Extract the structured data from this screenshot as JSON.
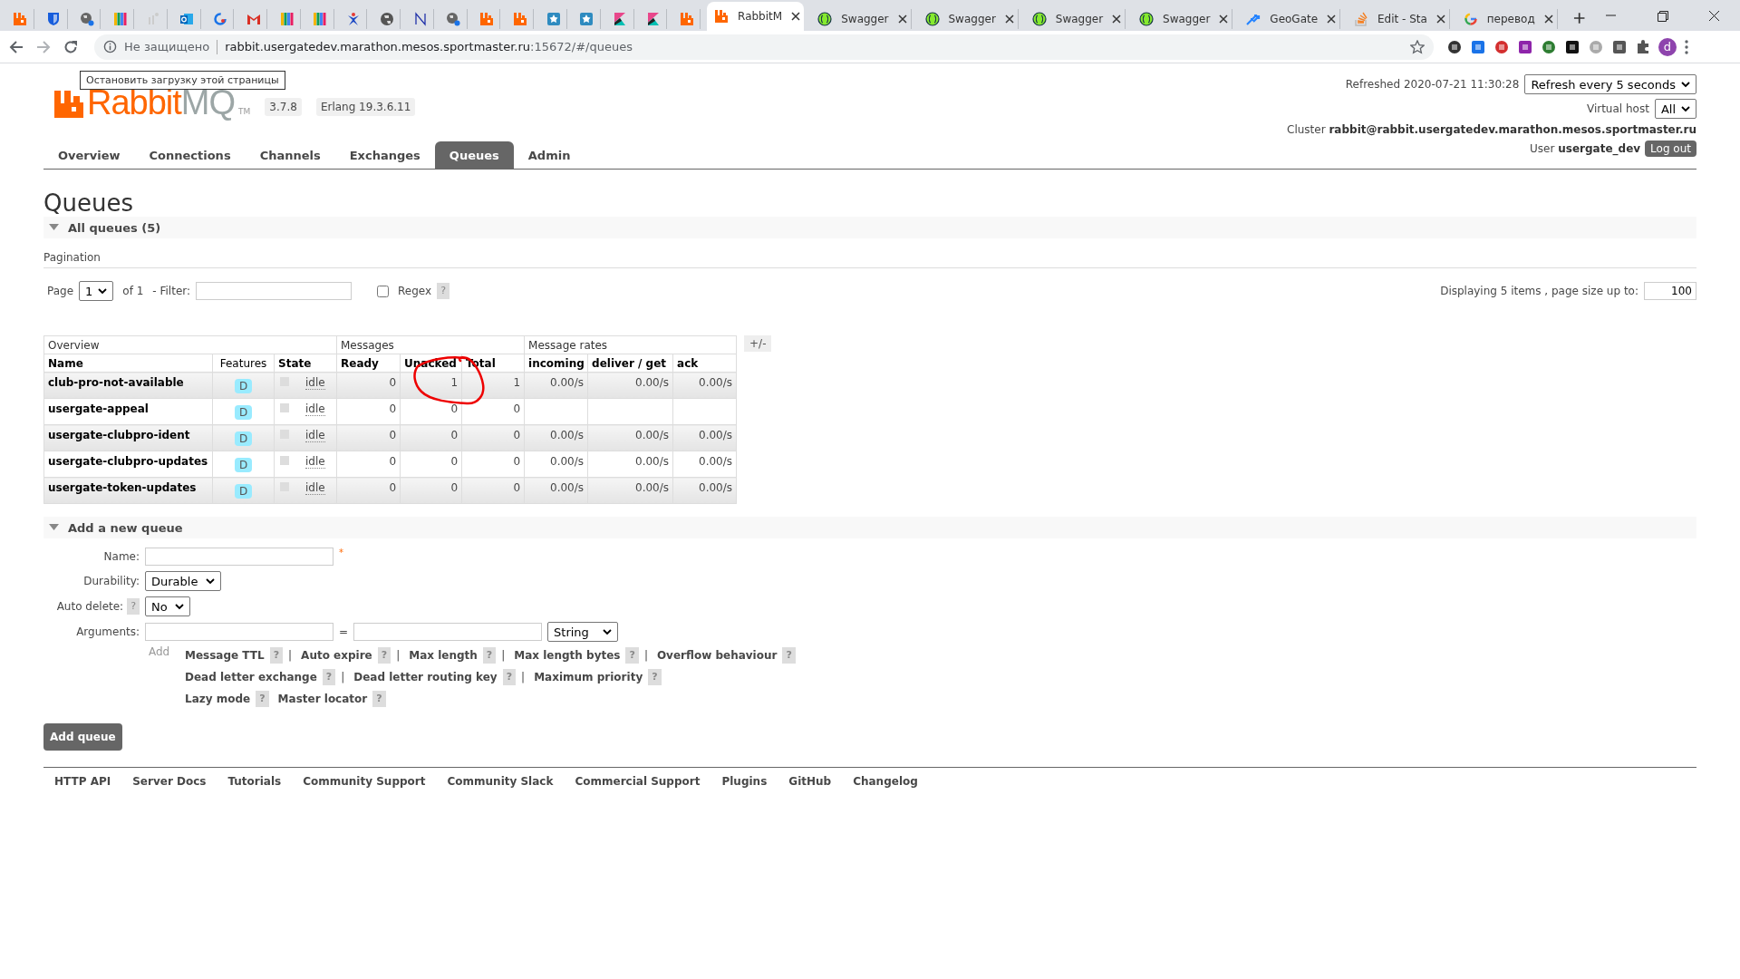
{
  "browser": {
    "tabs": [
      {
        "kind": "rabbit",
        "selected": false
      },
      {
        "kind": "shield",
        "selected": false
      },
      {
        "kind": "globedot",
        "selected": false
      },
      {
        "kind": "bars",
        "selected": false
      },
      {
        "kind": "sparkle",
        "selected": false
      },
      {
        "kind": "outlook",
        "selected": false
      },
      {
        "kind": "ringc",
        "selected": false
      },
      {
        "kind": "gmail",
        "selected": false
      },
      {
        "kind": "bars",
        "selected": false
      },
      {
        "kind": "bars",
        "selected": false
      },
      {
        "kind": "figure",
        "selected": false
      },
      {
        "kind": "globe",
        "selected": false
      },
      {
        "kind": "zigzag",
        "selected": false
      },
      {
        "kind": "globedot",
        "selected": false
      },
      {
        "kind": "rabbit",
        "selected": false
      },
      {
        "kind": "rabbit",
        "selected": false
      },
      {
        "kind": "gearsq",
        "selected": false
      },
      {
        "kind": "gearsq",
        "selected": false
      },
      {
        "kind": "kibana",
        "selected": false
      },
      {
        "kind": "kibana",
        "selected": false
      },
      {
        "kind": "rabbit",
        "selected": false
      },
      {
        "kind": "rabbit",
        "title": "RabbitM",
        "selected": true
      },
      {
        "kind": "swagger",
        "title": "Swagger",
        "selected": false
      },
      {
        "kind": "swagger",
        "title": "Swagger",
        "selected": false
      },
      {
        "kind": "swagger",
        "title": "Swagger",
        "selected": false
      },
      {
        "kind": "swagger",
        "title": "Swagger",
        "selected": false
      },
      {
        "kind": "geogate",
        "title": "GeoGate",
        "selected": false
      },
      {
        "kind": "stack",
        "title": "Edit - Sta",
        "selected": false
      },
      {
        "kind": "google",
        "title": "перевод",
        "selected": false
      }
    ],
    "security": "Не защищено",
    "url_host": "rabbit.usergatedev.marathon.mesos.sportmaster.ru",
    "url_rest": ":15672/#/queues",
    "profile_initial": "d"
  },
  "tooltip": "Остановить загрузку этой страницы",
  "logo": {
    "parts": [
      "Rabbit",
      "MQ"
    ],
    "mark": "TM"
  },
  "versions": [
    "3.7.8",
    "Erlang 19.3.6.11"
  ],
  "refreshed": "Refreshed 2020-07-21 11:30:28",
  "refresh_select": "Refresh every 5 seconds",
  "virtual_host_label": "Virtual host",
  "virtual_host_select": "All",
  "cluster": "Cluster **rabbit@rabbit.usergatedev.marathon.mesos.sportmaster.ru**",
  "user": "User **usergate_dev**",
  "logout": "Log out",
  "nav": [
    {
      "label": "Overview",
      "selected": false
    },
    {
      "label": "Connections",
      "selected": false
    },
    {
      "label": "Channels",
      "selected": false
    },
    {
      "label": "Exchanges",
      "selected": false
    },
    {
      "label": "Queues",
      "selected": true
    },
    {
      "label": "Admin",
      "selected": false
    }
  ],
  "heading": "Queues",
  "all_queues": {
    "title": "All queues (5)",
    "expanded": true
  },
  "pagination": {
    "label": "Pagination",
    "page_label": "Page",
    "page": "1",
    "of": "of 1",
    "filter_label": "- Filter:",
    "regex_label": "Regex",
    "regex": false,
    "help": "?",
    "displaying": "Displaying 5 items , page size up to:",
    "page_size": "100"
  },
  "table": {
    "groups": [
      {
        "label": "Overview"
      },
      {
        "label": "Messages"
      },
      {
        "label": "Message rates"
      }
    ],
    "toggle": "+/-",
    "columns": [
      "Name",
      "Features",
      "State",
      "Ready",
      "Unacked",
      "Total",
      "incoming",
      "deliver / get",
      "ack"
    ],
    "rows": [
      {
        "name": "club-pro-not-available",
        "feature": "D",
        "state": "idle",
        "ready": "0",
        "unacked": "1",
        "total": "1",
        "incoming": "0.00/s",
        "deliver": "0.00/s",
        "ack": "0.00/s"
      },
      {
        "name": "usergate-appeal",
        "feature": "D",
        "state": "idle",
        "ready": "0",
        "unacked": "0",
        "total": "0"
      },
      {
        "name": "usergate-clubpro-ident",
        "feature": "D",
        "state": "idle",
        "ready": "0",
        "unacked": "0",
        "total": "0",
        "incoming": "0.00/s",
        "deliver": "0.00/s",
        "ack": "0.00/s"
      },
      {
        "name": "usergate-clubpro-updates",
        "feature": "D",
        "state": "idle",
        "ready": "0",
        "unacked": "0",
        "total": "0",
        "incoming": "0.00/s",
        "deliver": "0.00/s",
        "ack": "0.00/s"
      },
      {
        "name": "usergate-token-updates",
        "feature": "D",
        "state": "idle",
        "ready": "0",
        "unacked": "0",
        "total": "0",
        "incoming": "0.00/s",
        "deliver": "0.00/s",
        "ack": "0.00/s"
      }
    ]
  },
  "add_queue": {
    "title": "Add a new queue",
    "expanded": true,
    "name_label": "Name:",
    "required": "*",
    "durability_label": "Durability:",
    "durability": "Durable",
    "auto_delete_label": "Auto delete:",
    "auto_delete": "No",
    "arguments_label": "Arguments:",
    "equals": "=",
    "arg_type": "String",
    "add_label": "Add",
    "help": "?",
    "argument_rows": [
      [
        {
          "label": "Message TTL",
          "sep": "|"
        },
        {
          "label": "Auto expire",
          "sep": "|"
        },
        {
          "label": "Max length",
          "sep": "|"
        },
        {
          "label": "Max length bytes",
          "sep": "|"
        },
        {
          "label": "Overflow behaviour"
        }
      ],
      [
        {
          "label": "Dead letter exchange",
          "sep": "|"
        },
        {
          "label": "Dead letter routing key",
          "sep": "|"
        },
        {
          "label": "Maximum priority"
        }
      ],
      [
        {
          "label": "Lazy mode"
        },
        {
          "label": "Master locator"
        }
      ]
    ],
    "button": "Add queue"
  },
  "footer": [
    "HTTP API",
    "Server Docs",
    "Tutorials",
    "Community Support",
    "Community Slack",
    "Commercial Support",
    "Plugins",
    "GitHub",
    "Changelog"
  ]
}
